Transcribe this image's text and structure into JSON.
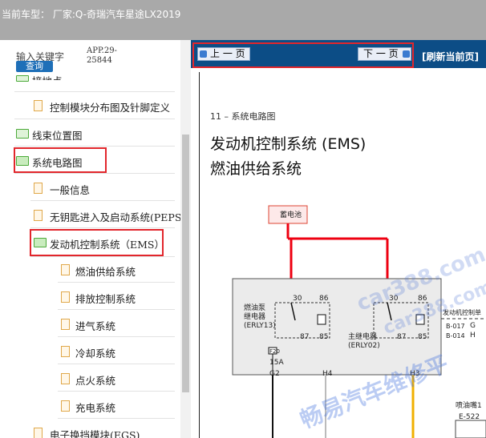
{
  "header": {
    "title": "当前车型：  厂家:Q-奇瑞汽车星途LX2019"
  },
  "search": {
    "placeholder": "输入关键字",
    "button": "查询",
    "app_line1": "APP.29-",
    "app_line2": "25844"
  },
  "tree": {
    "items": [
      {
        "label": "接地点"
      },
      {
        "label": "控制模块分布图及针脚定义"
      },
      {
        "label": "线束位置图"
      },
      {
        "label": "系统电路图"
      },
      {
        "label": "一般信息"
      },
      {
        "label": "无钥匙进入及启动系统(PEPS"
      },
      {
        "label": "发动机控制系统（EMS）"
      },
      {
        "label": "燃油供给系统"
      },
      {
        "label": "排放控制系统"
      },
      {
        "label": "进气系统"
      },
      {
        "label": "冷却系统"
      },
      {
        "label": "点火系统"
      },
      {
        "label": "充电系统"
      },
      {
        "label": "电子换挡模块(EGS)"
      }
    ]
  },
  "nav": {
    "prev": "上 一 页",
    "next": "下 一 页",
    "refresh": "[刷新当前页]"
  },
  "doc": {
    "section": "11 – 系统电路图",
    "title1": "发动机控制系统 (EMS)",
    "title2": "燃油供给系统",
    "battery": "蓄电池",
    "relay1_line1": "燃油泵",
    "relay1_line2": "继电器",
    "relay1_line3": "(ERLY13)",
    "relay2_line1": "主继电器",
    "relay2_line2": "(ERLY02)",
    "pin30a": "30",
    "pin86a": "86",
    "pin87a": "87",
    "pin85a": "85",
    "pin30b": "30",
    "pin86b": "86",
    "pin87b": "87",
    "pin85b": "85",
    "fuse": "15A",
    "fuse_id": "F20",
    "g2": "G2",
    "h4": "H4",
    "h3": "H3",
    "right_text": "喷油嘴1",
    "conn": "E-522",
    "b017": "B-017",
    "b014": "B-014",
    "g": "G",
    "h": "H",
    "ecm_cut": "发动机控制单"
  },
  "watermark": {
    "text1": "car388.com",
    "text2": "car388.com",
    "text3": "畅易汽车维修平"
  }
}
